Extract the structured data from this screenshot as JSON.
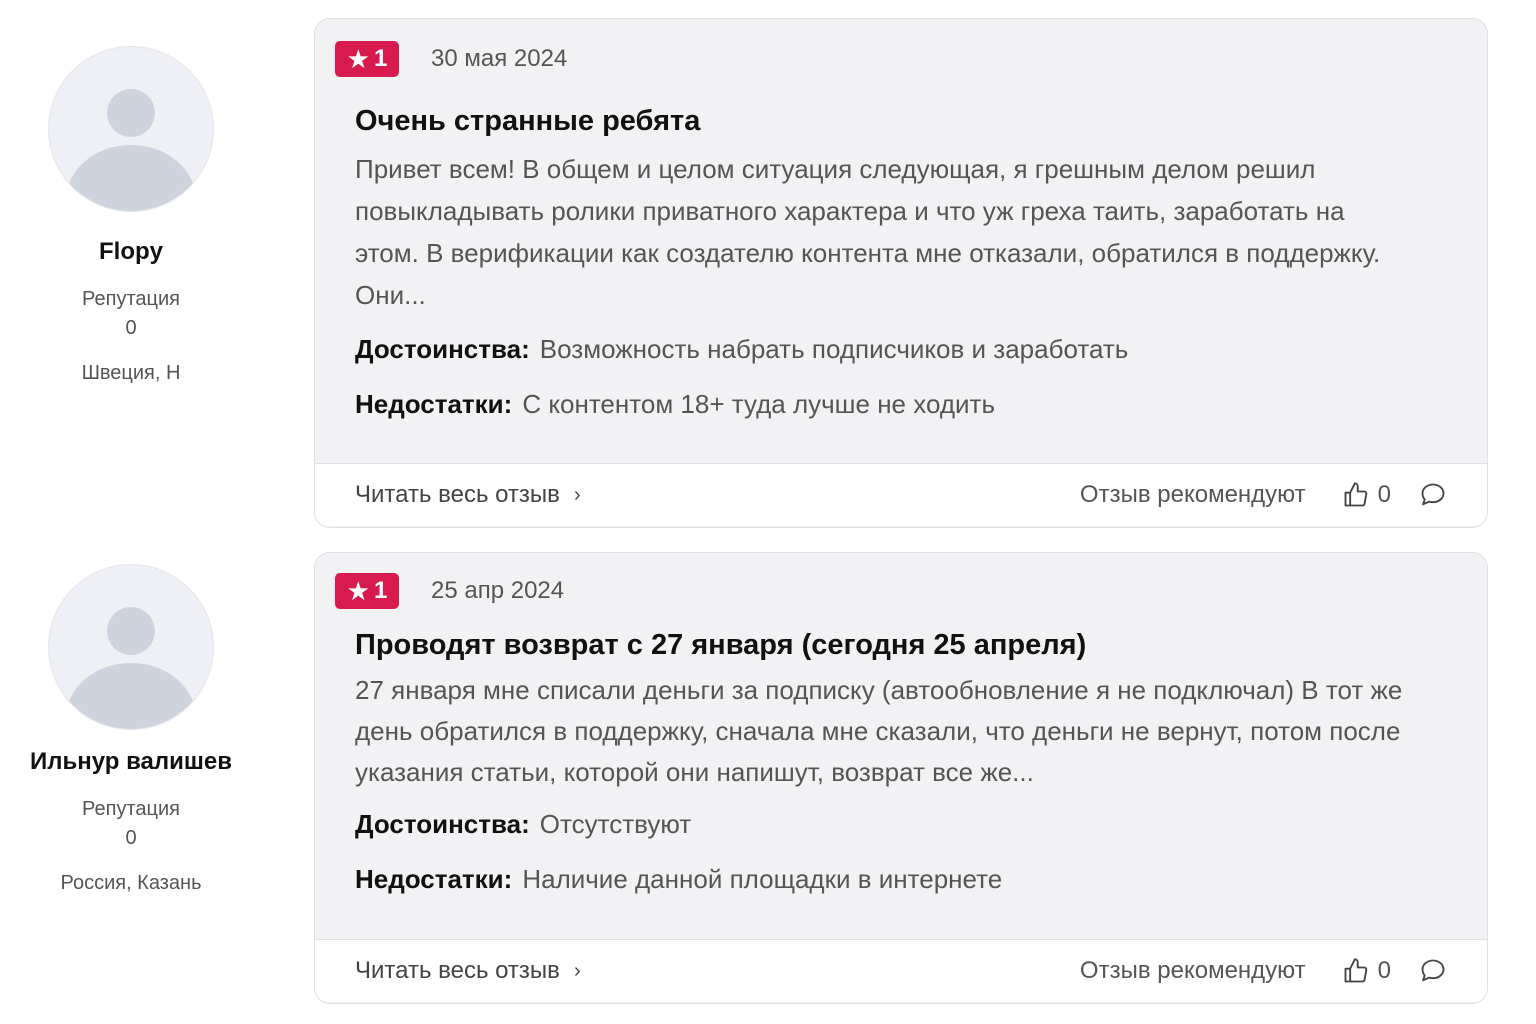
{
  "reviews": [
    {
      "author": {
        "name": "Flopy",
        "reputation_label": "Репутация",
        "reputation_value": "0",
        "location": "Швеция, Н"
      },
      "rating": "1",
      "date": "30 мая 2024",
      "title": "Очень странные ребята",
      "text": "Привет всем! В общем и целом ситуация следующая, я грешным делом решил повыкладывать ролики приватного характера и что уж греха таить, заработать на этом. В верификации как создателю контента мне отказали, обратился в поддержку. Они...",
      "pros_label": "Достоинства:",
      "pros": "Возможность набрать подписчиков и заработать",
      "cons_label": "Недостатки:",
      "cons": "С контентом 18+ туда лучше не ходить",
      "read_more": "Читать весь отзыв",
      "recommend": "Отзыв рекомендуют",
      "likes": "0"
    },
    {
      "author": {
        "name": "Ильнур валишев",
        "reputation_label": "Репутация",
        "reputation_value": "0",
        "location": "Россия, Казань"
      },
      "rating": "1",
      "date": "25 апр 2024",
      "title": "Проводят возврат с 27 января (сегодня 25 апреля)",
      "text": "27 января мне списали деньги за подписку (автообновление я не подключал) В тот же день обратился в поддержку, сначала мне сказали, что деньги не вернут, потом после указания статьи, которой они напишут, возврат все же...",
      "pros_label": "Достоинства:",
      "pros": "Отсутствуют",
      "cons_label": "Недостатки:",
      "cons": "Наличие данной площадки в интернете",
      "read_more": "Читать весь отзыв",
      "recommend": "Отзыв рекомендуют",
      "likes": "0"
    }
  ],
  "colors": {
    "rating_badge": "#d81b4f",
    "card_bg": "#f2f2f4"
  },
  "icons": {
    "rating": "star-icon",
    "read_more": "chevron-right-icon",
    "like": "thumbs-up-icon",
    "comment": "comment-icon"
  }
}
